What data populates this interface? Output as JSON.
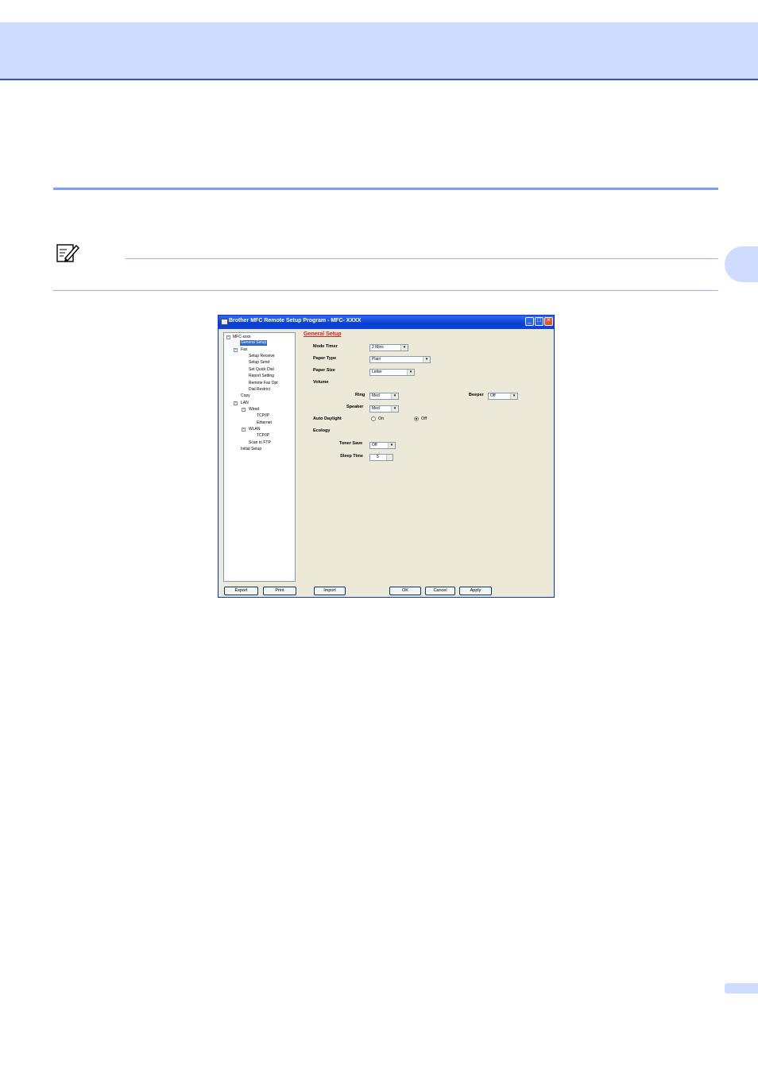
{
  "window": {
    "title": "Brother MFC Remote Setup Program - MFC- XXXX",
    "minimize_glyph": "_",
    "maximize_glyph": "□",
    "close_glyph": "×"
  },
  "tree": {
    "expand_glyph": "-",
    "items": [
      "MFC-xxxx",
      "General Setup",
      "Fax",
      "Setup Receive",
      "Setup Send",
      "Set Quick Dial",
      "Report Setting",
      "Remote Fax Opt",
      "Dial Restrict",
      "Copy",
      "LAN",
      "Wired",
      "TCP/IP",
      "Ethernet",
      "WLAN",
      "TCP/IP",
      "Scan to FTP",
      "Initial Setup"
    ]
  },
  "general_setup": {
    "title": "General Setup",
    "combo_arrow": "▾",
    "mode_timer": {
      "label": "Mode Timer",
      "value": "2 Mins"
    },
    "paper_type": {
      "label": "Paper Type",
      "value": "Plain"
    },
    "paper_size": {
      "label": "Paper Size",
      "value": "Letter"
    },
    "volume": {
      "label": "Volume",
      "ring": {
        "label": "Ring",
        "value": "Med"
      },
      "speaker": {
        "label": "Speaker",
        "value": "Med"
      },
      "beeper": {
        "label": "Beeper",
        "value": "Off"
      }
    },
    "auto_daylight": {
      "label": "Auto Daylight",
      "on_label": "On",
      "off_label": "Off",
      "selected": "Off"
    },
    "ecology": {
      "label": "Ecology",
      "toner_save": {
        "label": "Toner Save",
        "value": "Off"
      },
      "sleep_time": {
        "label": "Sleep Time",
        "value": "5"
      }
    }
  },
  "buttons": {
    "export": "Export",
    "print": "Print",
    "import": "Import",
    "ok": "OK",
    "cancel": "Cancel",
    "apply": "Apply"
  }
}
